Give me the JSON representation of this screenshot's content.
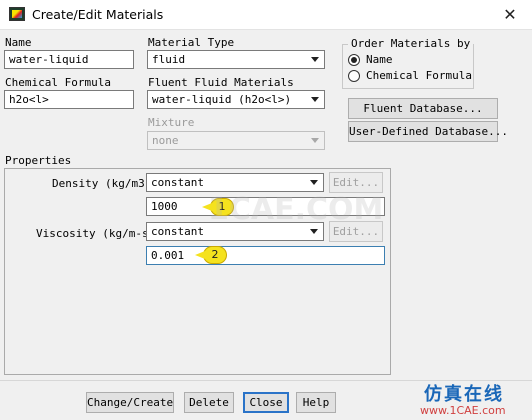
{
  "window": {
    "title": "Create/Edit Materials",
    "close_glyph": "✕"
  },
  "name": {
    "label": "Name",
    "value": "water-liquid"
  },
  "chemical_formula": {
    "label": "Chemical Formula",
    "value": "h2o<l>"
  },
  "material_type": {
    "label": "Material Type",
    "value": "fluid"
  },
  "fluent_fluid_materials": {
    "label": "Fluent Fluid Materials",
    "value": "water-liquid (h2o<l>)"
  },
  "mixture": {
    "label": "Mixture",
    "value": "none"
  },
  "order_by": {
    "legend": "Order Materials by",
    "options": [
      "Name",
      "Chemical Formula"
    ],
    "selected": "Name"
  },
  "databases": {
    "fluent_button": "Fluent Database...",
    "user_button": "User-Defined Database..."
  },
  "properties": {
    "legend": "Properties",
    "density": {
      "label": "Density (kg/m3)",
      "method": "constant",
      "edit_button": "Edit...",
      "value": "1000",
      "marker": "1"
    },
    "viscosity": {
      "label": "Viscosity (kg/m-s)",
      "method": "constant",
      "edit_button": "Edit...",
      "value": "0.001",
      "marker": "2"
    }
  },
  "actions": {
    "change_create": "Change/Create",
    "delete": "Delete",
    "close": "Close",
    "help": "Help"
  },
  "watermark": {
    "cn_text": "仿真在线",
    "url": "www.1CAE.com",
    "faint": "1CAE.COM"
  },
  "colors": {
    "accent": "#2a73c8",
    "marker": "#f5e21e",
    "watermark_blue": "#1a67b8",
    "watermark_red": "#d04040"
  }
}
